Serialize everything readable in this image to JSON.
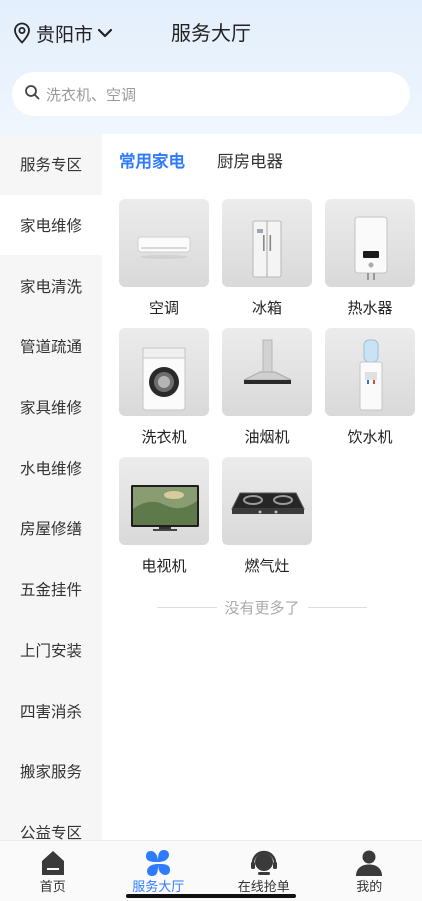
{
  "header": {
    "city": "贵阳市",
    "title": "服务大厅"
  },
  "search": {
    "placeholder": "洗衣机、空调"
  },
  "sidebar": {
    "items": [
      {
        "label": "服务专区"
      },
      {
        "label": "家电维修"
      },
      {
        "label": "家电清洗"
      },
      {
        "label": "管道疏通"
      },
      {
        "label": "家具维修"
      },
      {
        "label": "水电维修"
      },
      {
        "label": "房屋修缮"
      },
      {
        "label": "五金挂件"
      },
      {
        "label": "上门安装"
      },
      {
        "label": "四害消杀"
      },
      {
        "label": "搬家服务"
      },
      {
        "label": "公益专区"
      }
    ],
    "active_index": 1
  },
  "tabs": [
    {
      "label": "常用家电"
    },
    {
      "label": "厨房电器"
    }
  ],
  "products": [
    {
      "label": "空调",
      "icon": "air-conditioner-image"
    },
    {
      "label": "冰箱",
      "icon": "refrigerator-image"
    },
    {
      "label": "热水器",
      "icon": "water-heater-image"
    },
    {
      "label": "洗衣机",
      "icon": "washing-machine-image"
    },
    {
      "label": "油烟机",
      "icon": "range-hood-image"
    },
    {
      "label": "饮水机",
      "icon": "water-dispenser-image"
    },
    {
      "label": "电视机",
      "icon": "television-image"
    },
    {
      "label": "燃气灶",
      "icon": "gas-stove-image"
    }
  ],
  "footer_note": "没有更多了",
  "tabbar": [
    {
      "label": "首页",
      "icon": "home-icon"
    },
    {
      "label": "服务大厅",
      "icon": "service-hall-icon"
    },
    {
      "label": "在线抢单",
      "icon": "headset-icon"
    },
    {
      "label": "我的",
      "icon": "user-icon"
    }
  ],
  "colors": {
    "accent": "#2f7bff",
    "sidebar_bg": "#f6f6f6",
    "header_bg": "#e3effc"
  }
}
